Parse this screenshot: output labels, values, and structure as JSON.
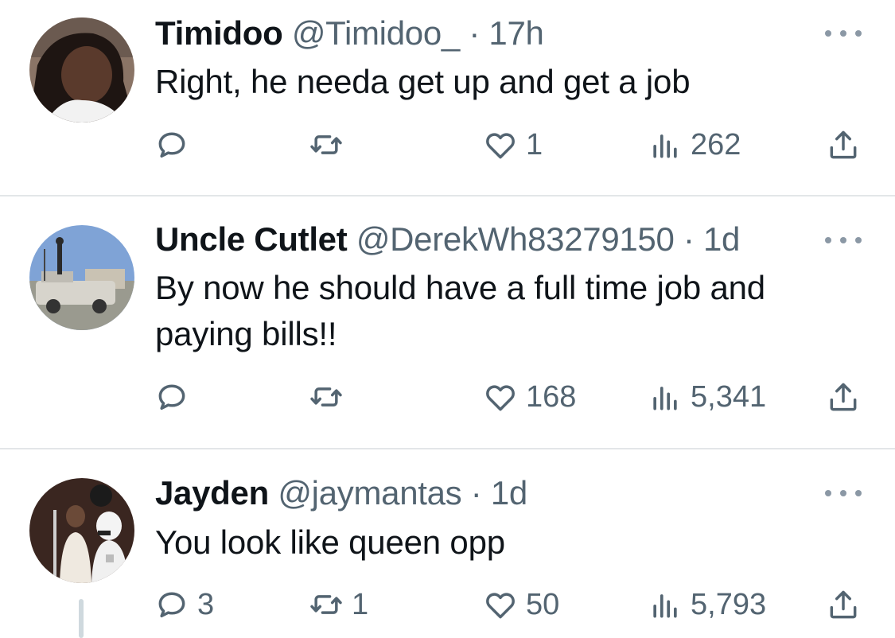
{
  "tweets": [
    {
      "name": "Timidoo",
      "handle": "@Timidoo_",
      "time": "17h",
      "text": "Right, he needa get up and get a job",
      "replies": "",
      "retweets": "",
      "likes": "1",
      "views": "262"
    },
    {
      "name": "Uncle Cutlet",
      "handle": "@DerekWh83279150",
      "time": "1d",
      "text_line1": "By now he should have a full time job and",
      "text_line2": "paying bills!!",
      "replies": "",
      "retweets": "",
      "likes": "168",
      "views": "5,341"
    },
    {
      "name": "Jayden",
      "handle": "@jaymantas",
      "time": "1d",
      "text": "You look like queen opp",
      "replies": "3",
      "retweets": "1",
      "likes": "50",
      "views": "5,793"
    }
  ],
  "separator": "·",
  "icons": [
    "reply-icon",
    "retweet-icon",
    "like-icon",
    "views-icon",
    "share-icon",
    "more-icon"
  ],
  "colors": {
    "text": "#0f1419",
    "secondary": "#536471",
    "divider": "#e3e6e8"
  }
}
